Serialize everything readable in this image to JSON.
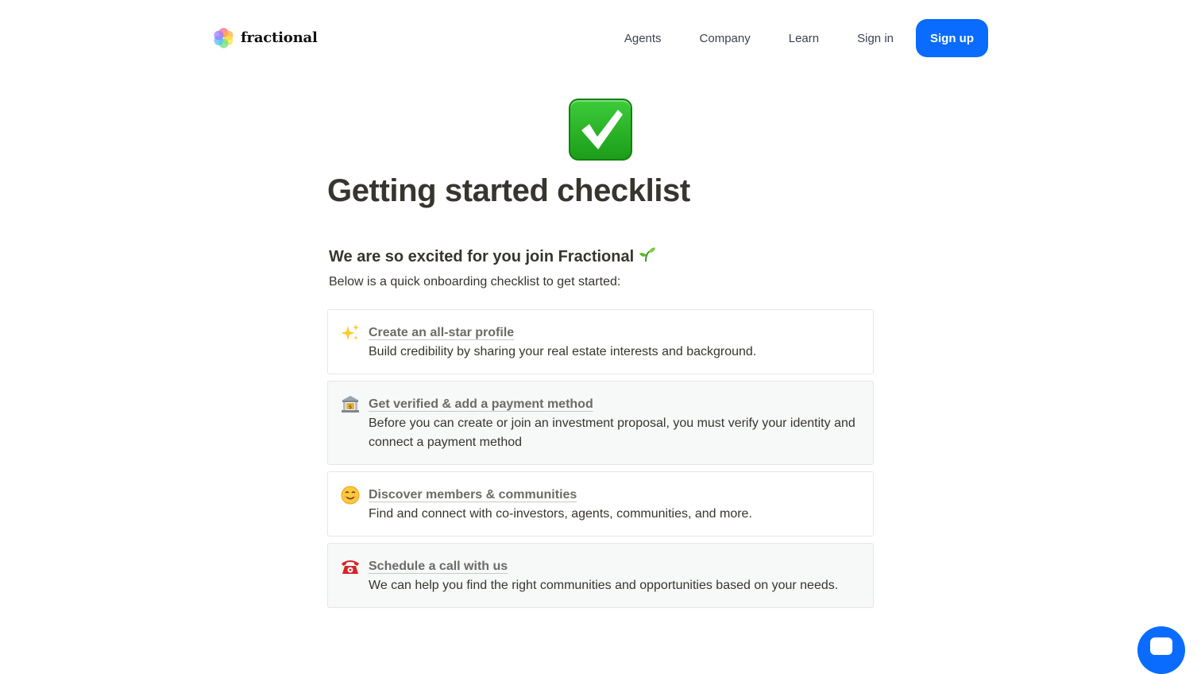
{
  "header": {
    "logo_text": "fractional",
    "nav": {
      "agents": "Agents",
      "company": "Company",
      "learn": "Learn",
      "signin": "Sign in",
      "signup": "Sign up"
    }
  },
  "page": {
    "icon": "check-mark-button-icon",
    "title": "Getting started checklist",
    "subtitle": "We are so excited for you join Fractional",
    "subtitle_icon": "seedling-icon",
    "intro": "Below is a quick onboarding checklist to get started:"
  },
  "checklist": [
    {
      "icon": "sparkles-icon",
      "title": "Create an all-star profile",
      "description": "Build credibility by sharing your real estate interests and background."
    },
    {
      "icon": "bank-icon",
      "title": "Get verified & add a payment method",
      "description": "Before you can create or join an investment proposal, you must verify your identity and connect a payment method"
    },
    {
      "icon": "smiling-face-icon",
      "title": "Discover members & communities",
      "description": "Find and connect with co-investors, agents, communities, and more."
    },
    {
      "icon": "telephone-icon",
      "title": "Schedule a call with us",
      "description": "We can help you find the right communities and opportunities based on your needs."
    }
  ],
  "colors": {
    "brand_blue": "#0a6cff",
    "text": "#37352f",
    "muted_title": "#6b6b68",
    "card_border": "#e6e6e4",
    "card_shaded_bg": "#f7f8f8",
    "check_green": "#2cb52a"
  },
  "chat": {
    "icon": "chat-bubble-icon"
  }
}
